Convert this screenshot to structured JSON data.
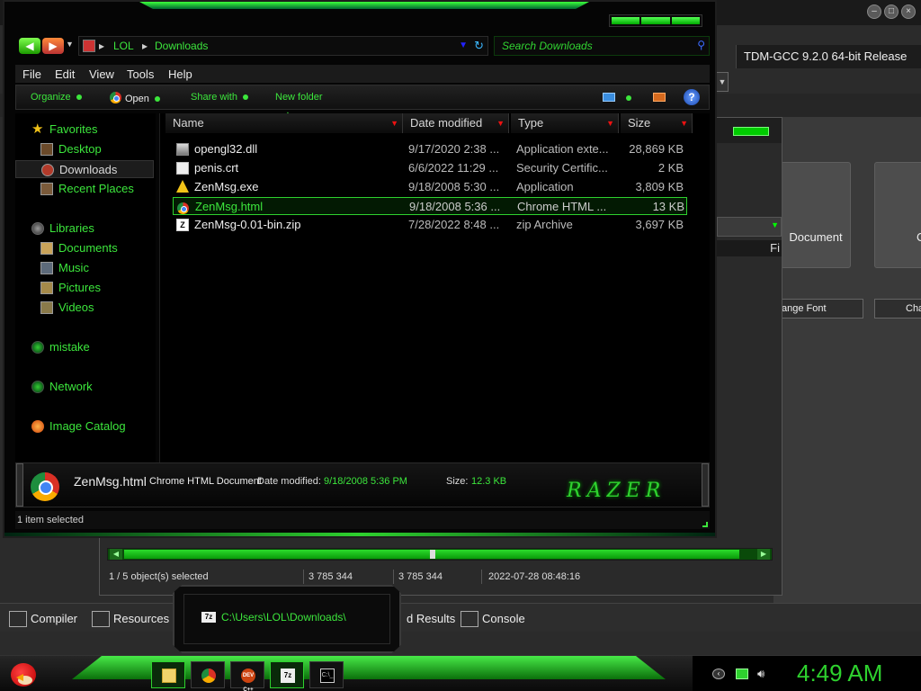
{
  "background_app": {
    "compiler_label": "TDM-GCC 9.2.0 64-bit Release",
    "tile_document": "Document",
    "tile_partial": "C",
    "btn_change_font": "ange Font",
    "btn_partial": "Cha",
    "fi_label": "Fi",
    "status": {
      "selected": "1 / 5 object(s) selected",
      "size1": "3 785 344",
      "size2": "3 785 344",
      "timestamp": "2022-07-28 08:48:16"
    },
    "bottom_tabs": {
      "compiler": "Compiler",
      "resources": "Resources",
      "results": "d Results",
      "console": "Console"
    }
  },
  "explorer": {
    "address": {
      "crumb1": "LOL",
      "crumb2": "Downloads"
    },
    "search": {
      "placeholder": "Search Downloads"
    },
    "menu": {
      "file": "File",
      "edit": "Edit",
      "view": "View",
      "tools": "Tools",
      "help": "Help"
    },
    "commands": {
      "organize": "Organize",
      "open": "Open",
      "share_with": "Share with",
      "new_folder": "New folder"
    },
    "nav": {
      "favorites": "Favorites",
      "desktop": "Desktop",
      "downloads": "Downloads",
      "recent_places": "Recent Places",
      "libraries": "Libraries",
      "documents": "Documents",
      "music": "Music",
      "pictures": "Pictures",
      "videos": "Videos",
      "mistake": "mistake",
      "network": "Network",
      "image_catalog": "Image Catalog"
    },
    "columns": {
      "name": "Name",
      "date": "Date modified",
      "type": "Type",
      "size": "Size"
    },
    "files": [
      {
        "name": "opengl32.dll",
        "date": "9/17/2020 2:38 ...",
        "type": "Application exte...",
        "size": "28,869 KB",
        "icon": "dll-icon"
      },
      {
        "name": "penis.crt",
        "date": "6/6/2022 11:29 ...",
        "type": "Security Certific...",
        "size": "2 KB",
        "icon": "certificate-icon"
      },
      {
        "name": "ZenMsg.exe",
        "date": "9/18/2008 5:30 ...",
        "type": "Application",
        "size": "3,809 KB",
        "icon": "warning-icon"
      },
      {
        "name": "ZenMsg.html",
        "date": "9/18/2008 5:36 ...",
        "type": "Chrome HTML ...",
        "size": "13 KB",
        "icon": "chrome-icon"
      },
      {
        "name": "ZenMsg-0.01-bin.zip",
        "date": "7/28/2022 8:48 ...",
        "type": "zip Archive",
        "size": "3,697 KB",
        "icon": "zip-icon"
      }
    ],
    "details": {
      "name": "ZenMsg.html",
      "type": "Chrome HTML Document",
      "date_label": "Date modified:",
      "date_value": "9/18/2008 5:36 PM",
      "size_label": "Size:",
      "size_value": "12.3 KB",
      "logo": "RAZER"
    },
    "status": "1 item selected"
  },
  "popup": {
    "path": "C:\\Users\\LOL\\Downloads\\"
  },
  "taskbar": {
    "clock": "4:49 AM",
    "dev_label": "DEV C++",
    "sevenzip_label": "7z",
    "cmd_label": "C:\\_"
  },
  "colors": {
    "accent": "#3ce63c",
    "background": "#050505"
  }
}
